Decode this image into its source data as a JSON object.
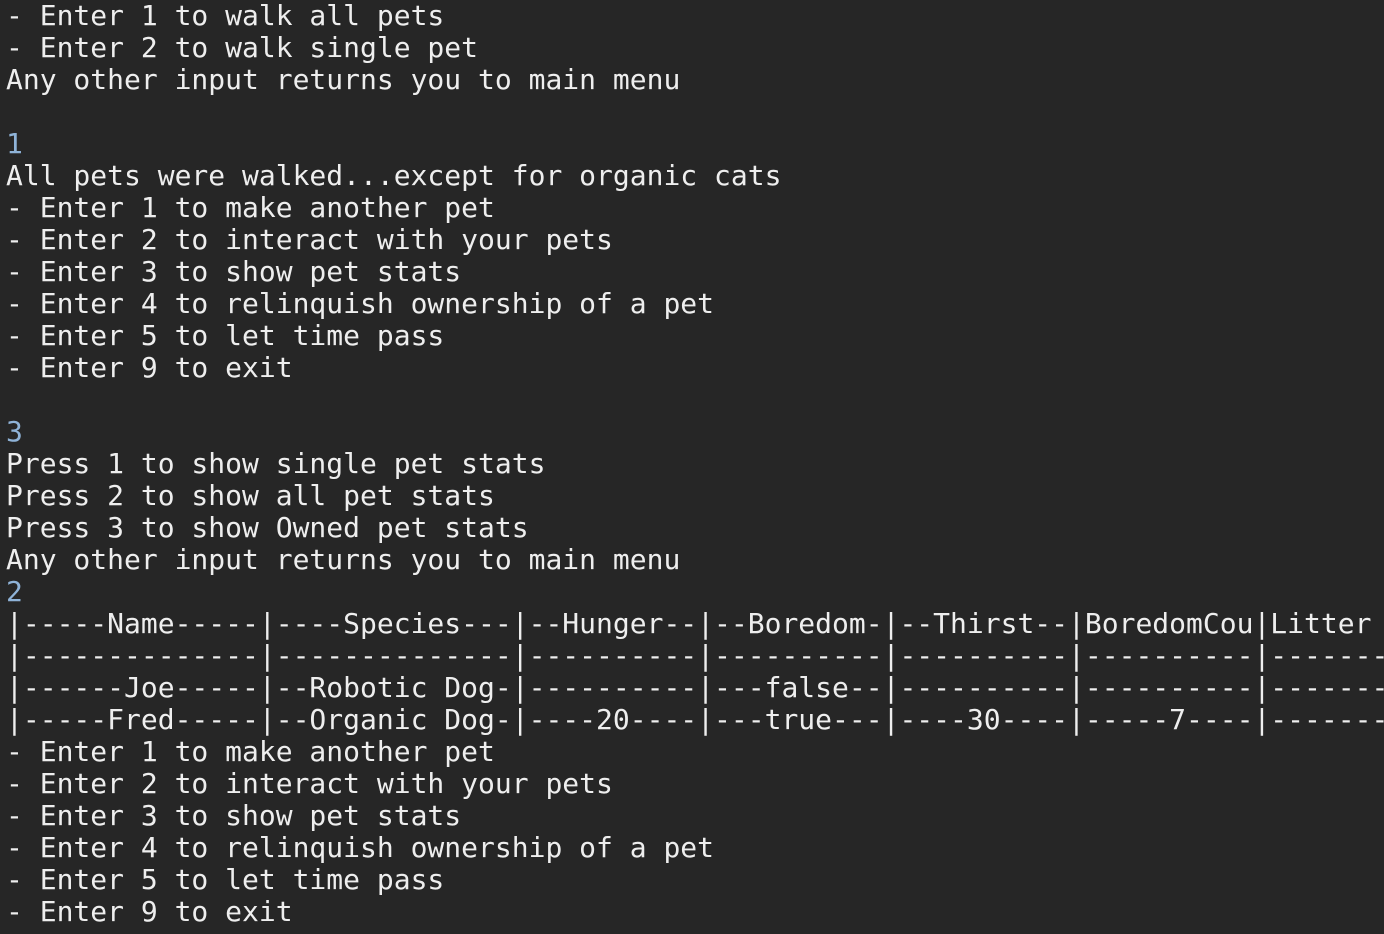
{
  "terminal": {
    "colors": {
      "background": "#262626",
      "output_text": "#eeeeee",
      "user_input": "#8fb3d8"
    },
    "walk_menu": [
      "- Enter 1 to walk all pets",
      "- Enter 2 to walk single pet",
      "Any other input returns you to main menu"
    ],
    "input_1": "1",
    "walk_result": "All pets were walked...except for organic cats",
    "main_menu_1": [
      "- Enter 1 to make another pet",
      "- Enter 2 to interact with your pets",
      "- Enter 3 to show pet stats",
      "- Enter 4 to relinquish ownership of a pet",
      "- Enter 5 to let time pass",
      "- Enter 9 to exit"
    ],
    "input_2": "3",
    "stats_menu": [
      "Press 1 to show single pet stats",
      "Press 2 to show all pet stats",
      "Press 3 to show Owned pet stats",
      "Any other input returns you to main menu"
    ],
    "input_3": "2",
    "table": {
      "header": "|-----Name-----|----Species---|--Hunger--|--Boredom-|--Thirst--|BoredomCou|Litter",
      "separator": "|--------------|--------------|----------|----------|----------|----------|-------",
      "rows": [
        "|------Joe-----|--Robotic Dog-|----------|---false--|----------|----------|-------",
        "|-----Fred-----|--Organic Dog-|----20----|---true---|----30----|-----7----|-------"
      ]
    },
    "main_menu_2": [
      "- Enter 1 to make another pet",
      "- Enter 2 to interact with your pets",
      "- Enter 3 to show pet stats",
      "- Enter 4 to relinquish ownership of a pet",
      "- Enter 5 to let time pass",
      "- Enter 9 to exit"
    ]
  }
}
